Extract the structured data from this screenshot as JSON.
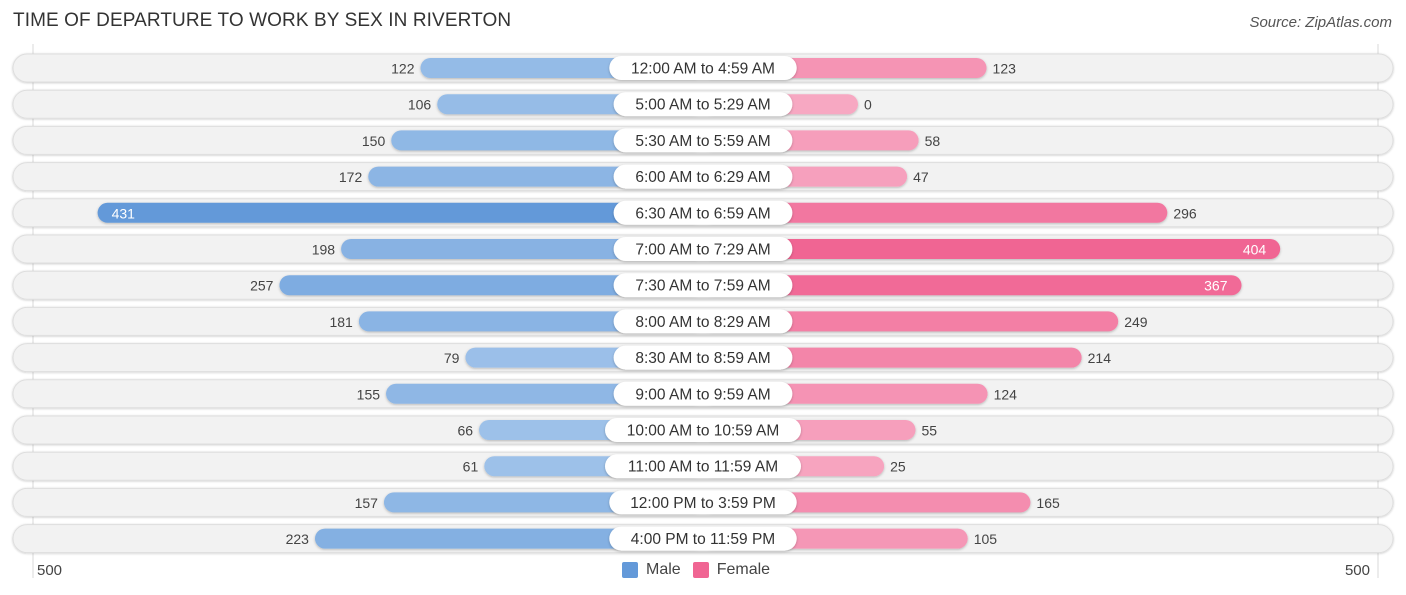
{
  "header": {
    "title": "TIME OF DEPARTURE TO WORK BY SEX IN RIVERTON",
    "source": "Source: ZipAtlas.com"
  },
  "colors": {
    "male_light": "#a7c8ec",
    "male_dark": "#6399d9",
    "female_light": "#f7a8c2",
    "female_dark": "#f06593",
    "row_bg": "#f2f2f2",
    "label_bg": "#ffffff"
  },
  "chart_data": {
    "type": "bar",
    "orientation": "horizontal-diverging",
    "title": "TIME OF DEPARTURE TO WORK BY SEX IN RIVERTON",
    "categories": [
      "12:00 AM to 4:59 AM",
      "5:00 AM to 5:29 AM",
      "5:30 AM to 5:59 AM",
      "6:00 AM to 6:29 AM",
      "6:30 AM to 6:59 AM",
      "7:00 AM to 7:29 AM",
      "7:30 AM to 7:59 AM",
      "8:00 AM to 8:29 AM",
      "8:30 AM to 8:59 AM",
      "9:00 AM to 9:59 AM",
      "10:00 AM to 10:59 AM",
      "11:00 AM to 11:59 AM",
      "12:00 PM to 3:59 PM",
      "4:00 PM to 11:59 PM"
    ],
    "series": [
      {
        "name": "Male",
        "values": [
          122,
          106,
          150,
          172,
          431,
          198,
          257,
          181,
          79,
          155,
          66,
          61,
          157,
          223
        ]
      },
      {
        "name": "Female",
        "values": [
          123,
          0,
          58,
          47,
          296,
          404,
          367,
          249,
          214,
          124,
          55,
          25,
          165,
          105
        ]
      }
    ],
    "axis": {
      "left_label": "500",
      "right_label": "500",
      "range": [
        -500,
        500
      ]
    },
    "legend": {
      "position": "bottom-center",
      "entries": [
        "Male",
        "Female"
      ]
    },
    "xlabel": "",
    "ylabel": "",
    "grid": false
  }
}
